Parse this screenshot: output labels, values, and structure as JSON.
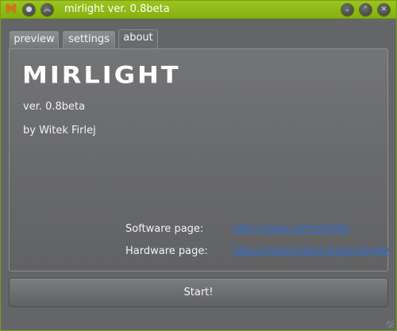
{
  "window": {
    "title": "mirlight ver. 0.8beta",
    "app_icon": "M"
  },
  "tabs": [
    {
      "label": "preview"
    },
    {
      "label": "settings"
    },
    {
      "label": "about"
    }
  ],
  "about": {
    "logo": "MIRLIGHT",
    "version": "ver. 0.8beta",
    "author": "by Witek Firlej",
    "software_label": "Software page:",
    "software_link": "http://grizz.pl/mirlight/",
    "hardware_label": "Hardware page:",
    "hardware_link": "http://mirley.firlej.org/mirlight/"
  },
  "start_button": "Start!",
  "colors": {
    "titlebar": "#8ab714",
    "background": "#646566",
    "link": "#2b6fd6"
  }
}
